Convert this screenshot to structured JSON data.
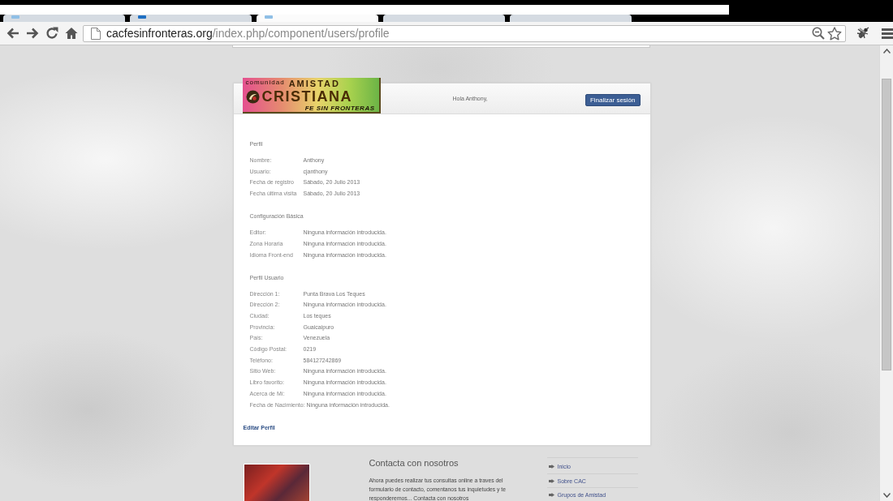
{
  "browser": {
    "tabs": [
      {
        "selected": false,
        "has_icon": true
      },
      {
        "selected": false,
        "has_icon": true
      },
      {
        "selected": true,
        "has_icon": true
      },
      {
        "selected": false,
        "has_icon": false
      },
      {
        "selected": false,
        "has_icon": false
      }
    ],
    "url": {
      "host": "cacfesinfronteras.org",
      "path": "/index.php/component/users/profile"
    }
  },
  "header": {
    "logo": {
      "top": "comunidad",
      "title": "AMISTAD",
      "subtitle": "CRISTIANA",
      "tagline": "FE SIN FRONTERAS"
    },
    "greeting": "Hola Anthony,",
    "logout_button": "Finalizar sesión"
  },
  "profile": {
    "sections": [
      {
        "title": "Perfil",
        "rows": [
          {
            "label": "Nombre:",
            "value": "Anthony"
          },
          {
            "label": "Usuario:",
            "value": "cjanthony"
          },
          {
            "label": "Fecha de registro",
            "value": "Sábado, 20 Julio 2013"
          },
          {
            "label": "Fecha última visita",
            "value": "Sábado, 20 Julio 2013"
          }
        ]
      },
      {
        "title": "Configuración Básica",
        "rows": [
          {
            "label": "Editor:",
            "value": "Ninguna información introducida."
          },
          {
            "label": "Zona Horaria",
            "value": "Ninguna información introducida."
          },
          {
            "label": "Idioma Front-end",
            "value": "Ninguna información introducida."
          }
        ]
      },
      {
        "title": "Perfil Usuario",
        "rows": [
          {
            "label": "Dirección 1:",
            "value": "Punta Brava Los Teques"
          },
          {
            "label": "Dirección 2:",
            "value": "Ninguna información introducida."
          },
          {
            "label": "Ciudad:",
            "value": "Los teques"
          },
          {
            "label": "Provincia:",
            "value": "Guaicaipuro"
          },
          {
            "label": "País:",
            "value": "Venezuela"
          },
          {
            "label": "Código Postal:",
            "value": "0219"
          },
          {
            "label": "Teléfono:",
            "value": "584127242869"
          },
          {
            "label": "Sitio Web:",
            "value": "Ninguna información introducida."
          },
          {
            "label": "Libro favorito:",
            "value": "Ninguna información introducida."
          },
          {
            "label": "Acerca de Mí:",
            "value": "Ninguna información introducida."
          },
          {
            "label": "Fecha de Nacimiento:",
            "value": "Ninguna información introducida."
          }
        ]
      }
    ],
    "edit_link": "Editar Perfil"
  },
  "footer": {
    "contact": {
      "title": "Contacta con nosotros",
      "text": "Ahora puedes realizar tus consultas online a traves del formulario de contacto, comentanos tus inquietudes y te responderemos... Contacta con nosotros"
    },
    "nav": [
      {
        "label": "Inicio"
      },
      {
        "label": "Sobre CAC"
      },
      {
        "label": "Grupos de Amistad"
      }
    ]
  }
}
